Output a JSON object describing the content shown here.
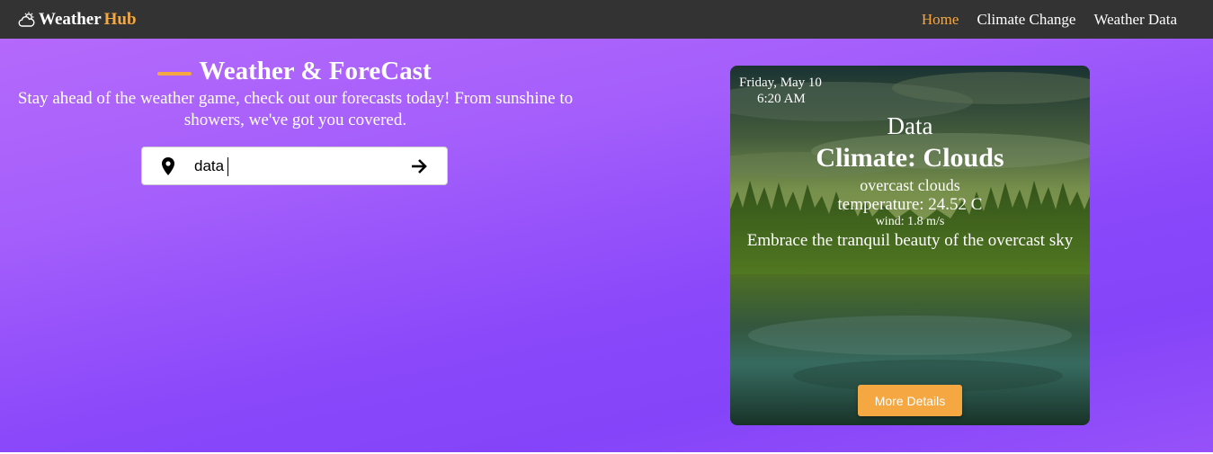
{
  "brand": {
    "name_main": "Weather",
    "name_accent": "Hub",
    "icon": "sun-cloud-icon"
  },
  "nav": {
    "items": [
      {
        "label": "Home",
        "active": true
      },
      {
        "label": "Climate Change",
        "active": false
      },
      {
        "label": "Weather Data",
        "active": false
      }
    ]
  },
  "hero": {
    "title": "Weather & ForeCast",
    "subtitle": "Stay ahead of the weather game, check out our forecasts today! From sunshine to showers, we've got you covered."
  },
  "search": {
    "value": "data",
    "location_icon": "map-pin-icon",
    "submit_icon": "arrow-right-icon"
  },
  "card": {
    "date": "Friday, May 10",
    "time": "6:20 AM",
    "heading": "Data",
    "climate": "Climate: Clouds",
    "description": "overcast clouds",
    "temperature": "temperature: 24.52 C",
    "wind": "wind: 1.8 m/s",
    "tagline": "Embrace the tranquil beauty of the overcast sky",
    "button_label": "More Details"
  },
  "colors": {
    "navbar": "#333333",
    "accent": "#f5a742",
    "gradient_light": "#b469fb",
    "gradient_dark": "#8544f9"
  }
}
